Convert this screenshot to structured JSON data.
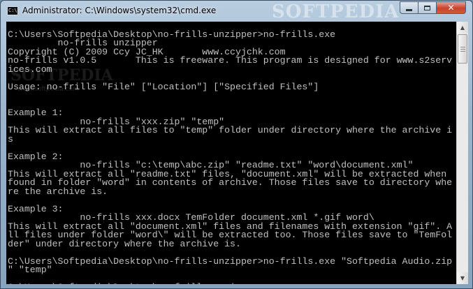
{
  "window": {
    "title": "Administrator: C:\\Windows\\system32\\cmd.exe",
    "icon": "cmd-icon",
    "icon_text": "C:\\",
    "watermark": "SOFTPEDIA",
    "buttons": {
      "minimize": "minimize-icon",
      "maximize": "maximize-icon",
      "close": "close-icon",
      "close_glyph": "✕"
    }
  },
  "console": {
    "lines": [
      "",
      "C:\\Users\\Softpedia\\Desktop\\no-frills-unzipper>no-frills.exe",
      "         no-frills unzipper",
      "Copyright (C) 2009 Ccy JC_HK       www.ccyjchk.com",
      "no-frills v1.0.5       This is freeware. This program is designed for www.s2serv",
      "ices.com",
      "",
      "Usage: no-frills \"File\" [\"Location\"] [\"Specified Files\"]",
      "",
      "",
      "Example 1:",
      "             no-frills \"xxx.zip\" \"temp\"",
      "This will extract all files to \"temp\" folder under directory where the archive i",
      "s",
      "",
      "Example 2:",
      "             no-frills \"c:\\temp\\abc.zip\" \"readme.txt\" \"word\\document.xml\"",
      "This will extract all \"readme.txt\" files, \"document.xml\" will be extracted when",
      "found in folder \"word\" in contents of archive. Those files save to directory whe",
      "re the archive is.",
      "",
      "Example 3:",
      "             no-frills xxx.docx TemFolder document.xml *.gif word\\",
      "This will extract all \"document.xml\" files and filenames with extension \"gif\". A",
      "ll files under folder \"word\\\" will be extracted too. Those files save to \"TemFol",
      "der\" under directory where the archive is.",
      "",
      "C:\\Users\\Softpedia\\Desktop\\no-frills-unzipper>no-frills.exe \"Softpedia Audio.zip",
      "\" \"temp\"",
      "",
      "C:\\Users\\Softpedia\\Desktop\\no-frills-unzipper>"
    ],
    "watermark": "SOFTPEDIA",
    "watermark_sub": "www.softpedia.com",
    "text_color": "#c0c0c0",
    "background": "#000000"
  },
  "scrollbar": {
    "up_arrow": "▲",
    "down_arrow": "▼"
  }
}
